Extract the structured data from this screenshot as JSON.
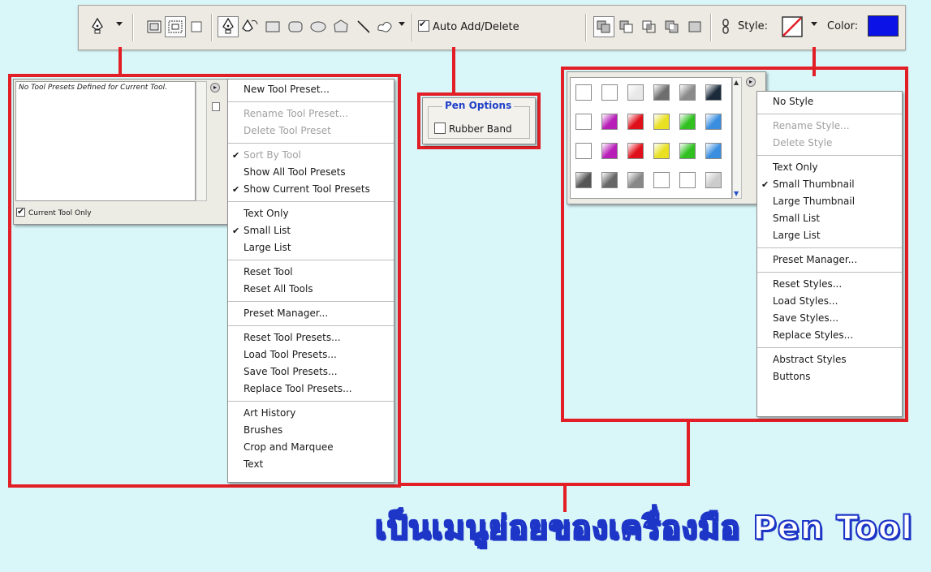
{
  "toolbar": {
    "auto_add_delete": {
      "label": "Auto Add/Delete",
      "checked": true
    },
    "style_label": "Style:",
    "color_label": "Color:",
    "color_value": "#0a12e6",
    "icons": [
      "pen-tool-icon",
      "shape-layers-icon",
      "paths-icon",
      "fill-pixels-icon",
      "pen-icon",
      "freeform-pen-icon",
      "rectangle-icon",
      "rounded-rectangle-icon",
      "ellipse-icon",
      "polygon-icon",
      "line-icon",
      "custom-shape-icon",
      "combine-icon",
      "subtract-icon",
      "intersect-icon",
      "exclude-icon",
      "link-icon"
    ]
  },
  "tool_presets_panel": {
    "empty_message": "No Tool Presets Defined for Current Tool.",
    "current_tool_only": {
      "label": "Current Tool Only",
      "checked": true
    }
  },
  "tool_presets_menu": {
    "groups": [
      [
        {
          "label": "New Tool Preset...",
          "disabled": false,
          "checked": false
        }
      ],
      [
        {
          "label": "Rename Tool Preset...",
          "disabled": true,
          "checked": false
        },
        {
          "label": "Delete Tool Preset",
          "disabled": true,
          "checked": false
        }
      ],
      [
        {
          "label": "Sort By Tool",
          "disabled": true,
          "checked": true
        },
        {
          "label": "Show All Tool Presets",
          "disabled": false,
          "checked": false
        },
        {
          "label": "Show Current Tool Presets",
          "disabled": false,
          "checked": true
        }
      ],
      [
        {
          "label": "Text Only",
          "disabled": false,
          "checked": false
        },
        {
          "label": "Small List",
          "disabled": false,
          "checked": true
        },
        {
          "label": "Large List",
          "disabled": false,
          "checked": false
        }
      ],
      [
        {
          "label": "Reset Tool",
          "disabled": false,
          "checked": false
        },
        {
          "label": "Reset All Tools",
          "disabled": false,
          "checked": false
        }
      ],
      [
        {
          "label": "Preset Manager...",
          "disabled": false,
          "checked": false
        }
      ],
      [
        {
          "label": "Reset Tool Presets...",
          "disabled": false,
          "checked": false
        },
        {
          "label": "Load Tool Presets...",
          "disabled": false,
          "checked": false
        },
        {
          "label": "Save Tool Presets...",
          "disabled": false,
          "checked": false
        },
        {
          "label": "Replace Tool Presets...",
          "disabled": false,
          "checked": false
        }
      ],
      [
        {
          "label": "Art History",
          "disabled": false,
          "checked": false
        },
        {
          "label": "Brushes",
          "disabled": false,
          "checked": false
        },
        {
          "label": "Crop and Marquee",
          "disabled": false,
          "checked": false
        },
        {
          "label": "Text",
          "disabled": false,
          "checked": false
        }
      ]
    ]
  },
  "pen_options": {
    "title": "Pen Options",
    "rubber_band": {
      "label": "Rubber Band",
      "checked": false
    }
  },
  "style_panel": {
    "swatch_colors": [
      [
        "#ffffff",
        "#ffffff",
        "#e8e8e8",
        "#6e6e6e",
        "#8b8b8b",
        "#1a2a3a"
      ],
      [
        "#ffffff",
        "#b81fb8",
        "#e0101a",
        "#e8e020",
        "#30c020",
        "#3a8ee0"
      ],
      [
        "#ffffff",
        "#b81fb8",
        "#e0101a",
        "#e8e020",
        "#30c020",
        "#3a8ee0"
      ],
      [
        "#555555",
        "#666666",
        "#888888",
        "#ffffff",
        "#ffffff",
        "#cccccc"
      ]
    ]
  },
  "style_menu": {
    "groups": [
      [
        {
          "label": "No Style",
          "disabled": false,
          "checked": false
        }
      ],
      [
        {
          "label": "Rename Style...",
          "disabled": true,
          "checked": false
        },
        {
          "label": "Delete Style",
          "disabled": true,
          "checked": false
        }
      ],
      [
        {
          "label": "Text Only",
          "disabled": false,
          "checked": false
        },
        {
          "label": "Small Thumbnail",
          "disabled": false,
          "checked": true
        },
        {
          "label": "Large Thumbnail",
          "disabled": false,
          "checked": false
        },
        {
          "label": "Small List",
          "disabled": false,
          "checked": false
        },
        {
          "label": "Large List",
          "disabled": false,
          "checked": false
        }
      ],
      [
        {
          "label": "Preset Manager...",
          "disabled": false,
          "checked": false
        }
      ],
      [
        {
          "label": "Reset Styles...",
          "disabled": false,
          "checked": false
        },
        {
          "label": "Load Styles...",
          "disabled": false,
          "checked": false
        },
        {
          "label": "Save Styles...",
          "disabled": false,
          "checked": false
        },
        {
          "label": "Replace Styles...",
          "disabled": false,
          "checked": false
        }
      ],
      [
        {
          "label": "Abstract Styles",
          "disabled": false,
          "checked": false
        },
        {
          "label": "Buttons",
          "disabled": false,
          "checked": false
        }
      ]
    ]
  },
  "caption": "เป็นเมนูย่อยของเครื่องมือ  Pen Tool",
  "colors": {
    "highlight": "#e21f26",
    "caption_stroke": "#1e36c7",
    "background": "#d9f6f8"
  }
}
